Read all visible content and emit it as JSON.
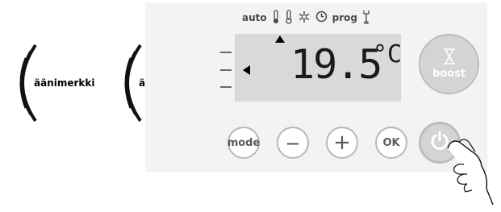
{
  "sound_label": "äänimerkki",
  "status_icons": {
    "auto": "auto",
    "prog": "prog",
    "icons": [
      "thermometer-comfort-icon",
      "thermometer-eco-icon",
      "frost-icon",
      "clock-icon",
      "wrench-icon"
    ]
  },
  "display": {
    "temperature": "19.5",
    "unit": "°C"
  },
  "buttons": {
    "mode": "mode",
    "minus": "—",
    "plus": "+",
    "ok": "OK",
    "boost": "boost",
    "power_icon": "power-icon",
    "boost_icon": "hourglass-icon"
  },
  "colors": {
    "panel": "#f3f3f3",
    "lcd": "#d9d9d9",
    "button_border": "#b8b8b8",
    "boost_fill": "#d4d4d4"
  }
}
